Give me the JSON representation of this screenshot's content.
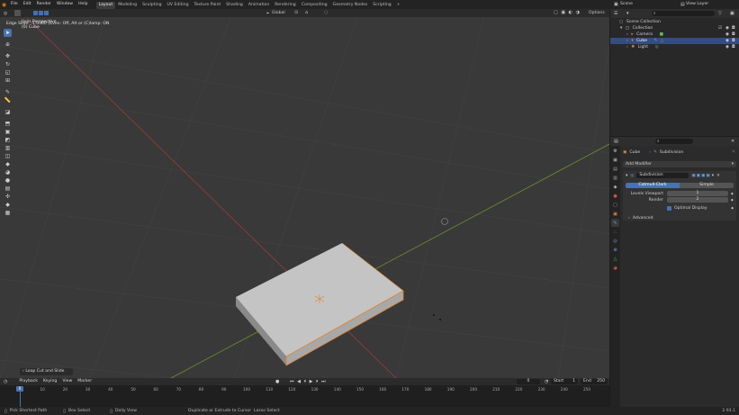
{
  "topbar": {
    "menus": [
      "File",
      "Edit",
      "Render",
      "Window",
      "Help"
    ],
    "workspaces": [
      "Layout",
      "Modeling",
      "Sculpting",
      "UV Editing",
      "Texture Paint",
      "Shading",
      "Animation",
      "Rendering",
      "Compositing",
      "Geometry Nodes",
      "Scripting"
    ],
    "active_workspace": "Layout",
    "add_tab": "+",
    "scene": "Scene",
    "view_layer": "View Layer"
  },
  "viewport": {
    "header_hint": "Edge Slide: -1.0000 (Even: Off, Alt or (C)lamp: ON",
    "transform_orientation": "Global",
    "options_label": "Options",
    "view_name": "User Perspective",
    "object_label": "(0) Cube",
    "operator_panel": "Loop Cut and Slide",
    "mesh_color": "#cccccc",
    "edge_highlight": "#e0822a",
    "bg_color": "#393939"
  },
  "timeline": {
    "menus": [
      "Playback",
      "Keying",
      "View",
      "Marker"
    ],
    "current_frame": "0",
    "start_label": "Start",
    "start_value": "1",
    "end_label": "End",
    "end_value": "250",
    "ticks": [
      "0",
      "10",
      "20",
      "30",
      "40",
      "50",
      "60",
      "70",
      "80",
      "90",
      "100",
      "110",
      "120",
      "130",
      "140",
      "150",
      "160",
      "170",
      "180",
      "190",
      "200",
      "210",
      "220",
      "230",
      "240",
      "250"
    ]
  },
  "statusbar": {
    "items": [
      "Pick Shortest Path",
      "Box Select",
      "Dolly View",
      "Duplicate or Extrude to Cursor",
      "Lasso Select"
    ],
    "version": "2.93.1"
  },
  "outliner": {
    "root": "Scene Collection",
    "collection": "Collection",
    "items": [
      "Camera",
      "Cube",
      "Light"
    ],
    "selected": "Cube"
  },
  "properties": {
    "object_name": "Cube",
    "modifier_breadcrumb": "Subdivision",
    "add_modifier": "Add Modifier",
    "modifier_name": "Subdivision",
    "mode_catmull": "Catmull-Clark",
    "mode_simple": "Simple",
    "levels_viewport_label": "Levels Viewport",
    "levels_viewport_value": "1",
    "render_label": "Render",
    "render_value": "2",
    "optimal_display": "Optimal Display",
    "advanced": "Advanced"
  }
}
